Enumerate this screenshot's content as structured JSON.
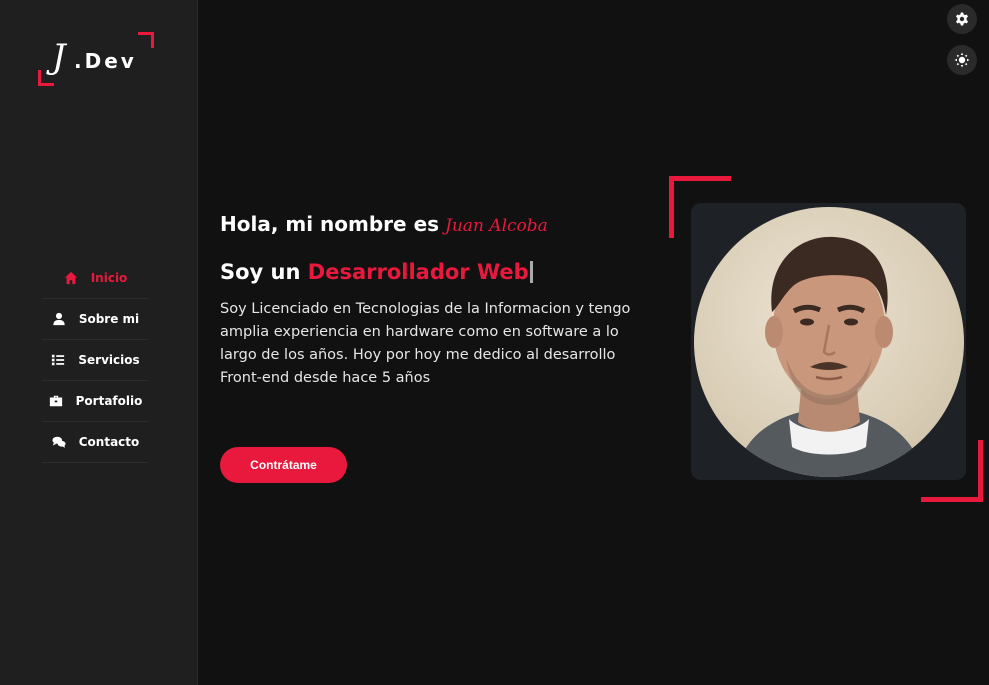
{
  "brand": {
    "logo_letter": "J",
    "logo_text": ".Dev"
  },
  "nav": {
    "items": [
      {
        "label": "Inicio",
        "icon": "home-icon",
        "active": true
      },
      {
        "label": "Sobre mi",
        "icon": "user-icon",
        "active": false
      },
      {
        "label": "Servicios",
        "icon": "list-icon",
        "active": false
      },
      {
        "label": "Portafolio",
        "icon": "briefcase-icon",
        "active": false
      },
      {
        "label": "Contacto",
        "icon": "comments-icon",
        "active": false
      }
    ]
  },
  "toggles": {
    "settings_icon": "gear-icon",
    "theme_icon": "sun-icon"
  },
  "hero": {
    "greeting": "Hola, mi nombre es",
    "name": "Juan Alcoba",
    "headline_prefix": "Soy un",
    "role": "Desarrollador Web",
    "bio": "Soy Licenciado en Tecnologias de la Informacion y tengo amplia experiencia en hardware como en software a lo largo de los años. Hoy por hoy me dedico al desarrollo Front-end desde hace 5 años",
    "cta_label": "Contrátame"
  },
  "colors": {
    "accent": "#e8193c",
    "background": "#111112",
    "sidebar": "#1f1f20",
    "card": "#1e2227"
  }
}
